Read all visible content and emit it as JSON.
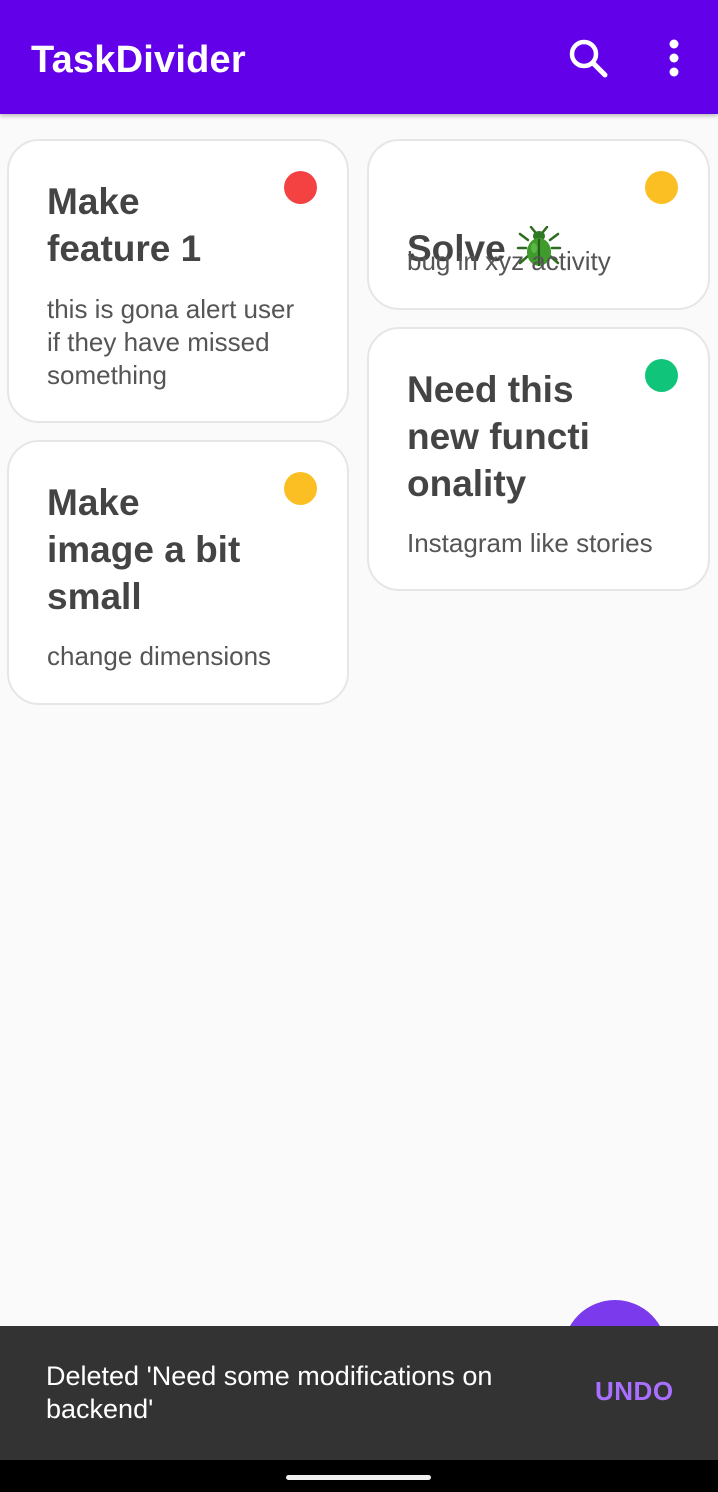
{
  "app_bar": {
    "title": "TaskDivider",
    "search_icon": "search-icon",
    "more_icon": "more-vert-icon",
    "background_color": "#6200ea"
  },
  "tasks": [
    {
      "title": "Make\nfeature 1",
      "description": "this is gona alert user\nif they have missed\nsomething",
      "priority_color": "#f44242"
    },
    {
      "title": "Make\nimage a bit\nsmall",
      "description": "change dimensions",
      "priority_color": "#fbbf24"
    },
    {
      "title": "Solve",
      "title_icon": "bug-icon",
      "description": "bug in xyz activity",
      "priority_color": "#fbbf24"
    },
    {
      "title": "Need this\nnew functi\nonality",
      "description": "Instagram like stories",
      "priority_color": "#10c47a"
    }
  ],
  "fab": {
    "icon": "add-icon",
    "color": "#7c3aed"
  },
  "snackbar": {
    "message": "Deleted 'Need some modifications on\nbackend'",
    "action_label": "UNDO",
    "action_color": "#a970ff"
  }
}
